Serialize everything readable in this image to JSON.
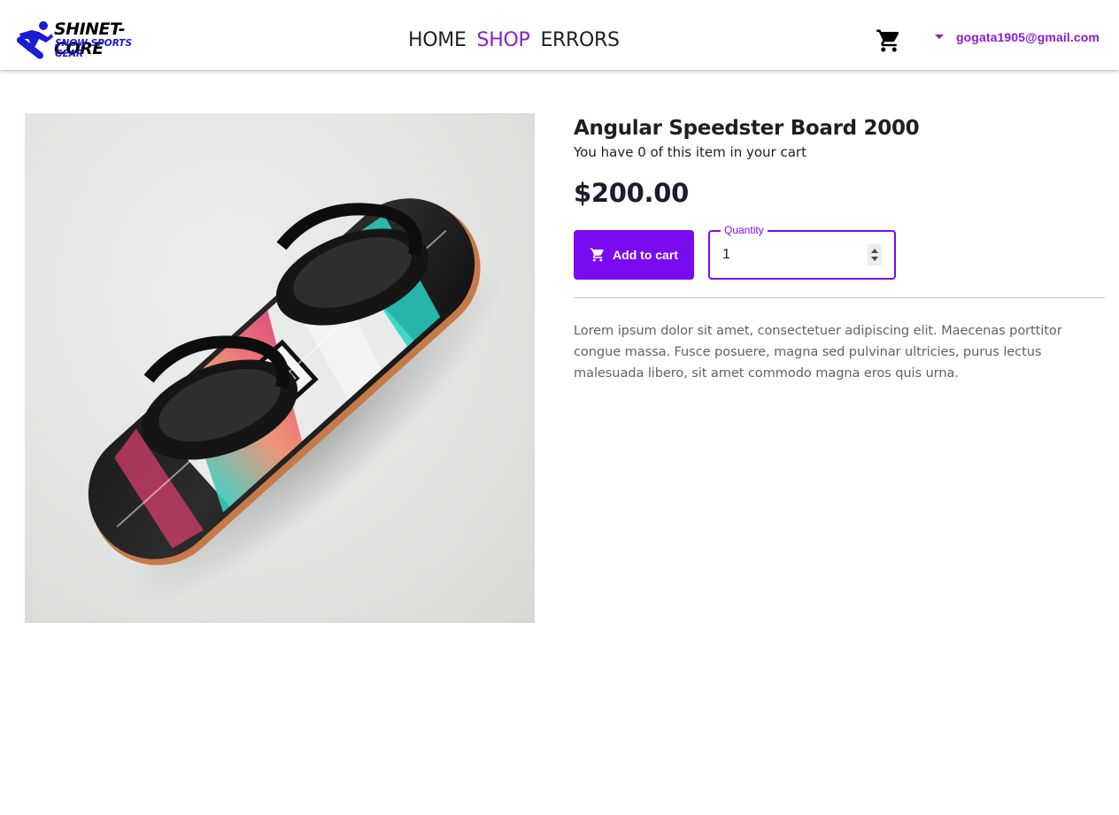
{
  "brand": {
    "name": "SHINET-CORE",
    "tagline": "SNOW SPORTS GEAR",
    "colors": {
      "primary": "#7a0bf0",
      "nav_active": "#8a1ccf",
      "logo_blue": "#1b1bd6"
    }
  },
  "nav": {
    "items": [
      {
        "label": "HOME",
        "active": false
      },
      {
        "label": "SHOP",
        "active": true
      },
      {
        "label": "ERRORS",
        "active": false
      }
    ]
  },
  "header": {
    "cart_icon": "shopping-cart-icon",
    "user_email": "gogata1905@gmail.com",
    "user_caret_icon": "caret-down-icon"
  },
  "product": {
    "title": "Angular Speedster Board 2000",
    "cart_count_text": "You have 0 of this item in your cart",
    "price": "$200.00",
    "add_button_label": "Add to cart",
    "add_button_icon": "add-shopping-cart-icon",
    "quantity_label": "Quantity",
    "quantity_value": "1",
    "description": "Lorem ipsum dolor sit amet, consectetuer adipiscing elit. Maecenas porttitor congue massa. Fusce posuere, magna sed pulvinar ultricies, purus lectus malesuada libero, sit amet commodo magna eros quis urna.",
    "image_subject": "snowboard-with-bindings"
  }
}
